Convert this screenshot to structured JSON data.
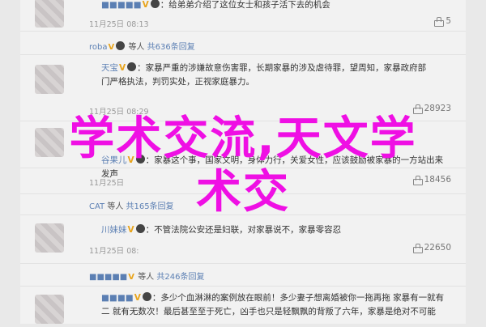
{
  "comments": [
    {
      "text_a": "：给弟弟介绍了这位女士和孩子活下去的机会",
      "time": "11月25日 08:13",
      "likes": "5",
      "reply_user": "",
      "reply_text": ""
    },
    {
      "user": "roba",
      "reply_user": "等人",
      "reply_text": "共636条回复"
    },
    {
      "user": "天宝",
      "line1": "：家暴严重的涉嫌故意伤害罪，长期家暴的涉及虐待罪，望周知，家暴政府部",
      "line2": "门严格执法，判罚实处，正视家庭暴力。",
      "time": "11月25日 08:29",
      "likes": "28923"
    },
    {
      "user": "谷果儿",
      "line1": "：家暴这个事，国家文明，身体力行，关爱女性，应该鼓励被家暴的一方站出来发声",
      "time": "11月25日 08:",
      "likes": "29056"
    },
    {
      "user": "ocjack",
      "line1": "：家暴事件被报道，其实背后有更多被家暴的人在沉默，希望她们都能被看见",
      "time": "11月25日",
      "likes": "18456"
    },
    {
      "user": "CAT",
      "reply_user": "等人",
      "reply_text": "共165条回复"
    },
    {
      "user": "川妹妹",
      "line1": "：不管法院公安还是妇联，对家暴说不，家暴零容忍",
      "time": "11月25日 08:",
      "likes": "22650"
    },
    {
      "user": "",
      "reply_user": "等人",
      "reply_text": "共246条回复"
    },
    {
      "user": "",
      "line1": "：多少个血淋淋的案例放在眼前！多少妻子想离婚被你一拖再拖 家暴有一就有",
      "line2": "二 就有无数次！最后甚至至于死亡，凶手也只是轻飘飘的背叛了六年，家暴是绝对不可能",
      "time": "",
      "likes": ""
    }
  ],
  "overlay": {
    "line1": "学术交流,天文学",
    "line2": "术交"
  }
}
